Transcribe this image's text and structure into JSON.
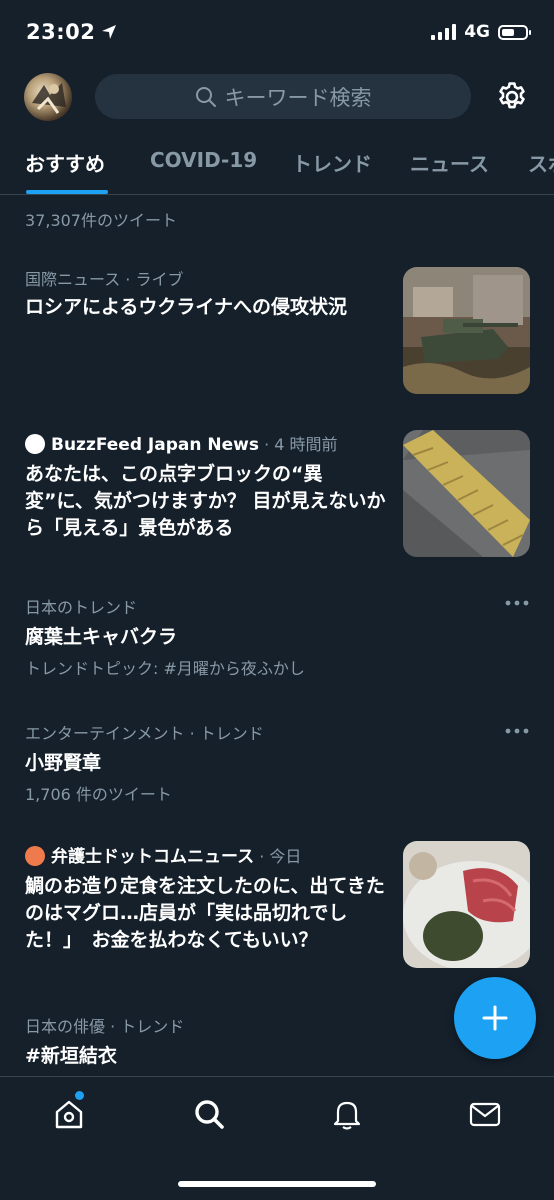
{
  "status_bar": {
    "time": "23:02",
    "network": "4G"
  },
  "header": {
    "search_placeholder": "キーワード検索"
  },
  "tabs": [
    {
      "label": "おすすめ"
    },
    {
      "label": "COVID-19"
    },
    {
      "label": "トレンド"
    },
    {
      "label": "ニュース"
    },
    {
      "label": "スポ"
    }
  ],
  "feed": {
    "partial_item": {
      "count": "37,307件のツイート"
    },
    "items": [
      {
        "category": "国際ニュース",
        "category_suffix": "· ライブ",
        "title": "ロシアによるウクライナへの侵攻状況"
      },
      {
        "source": "BuzzFeed Japan News",
        "time": "· 4 時間前",
        "title": "あなたは、この点字ブロックの“異変”に、気がつけますか？ 目が見えないから「見える」景色がある"
      },
      {
        "category": "日本のトレンド",
        "title": "腐葉土キャバクラ",
        "sub": "トレンドトピック: #月曜から夜ふかし"
      },
      {
        "category": "エンターテインメント · トレンド",
        "title": "小野賢章",
        "sub": "1,706 件のツイート"
      },
      {
        "source": "弁護士ドットコムニュース",
        "time": "· 今日",
        "title": "鯛のお造り定食を注文したのに、出てきたのはマグロ…店員が「実は品切れでした！」　お金を払わなくてもいい？"
      },
      {
        "category": "日本の俳優 · トレンド",
        "title": "#新垣結衣"
      }
    ]
  },
  "colors": {
    "background": "#15202b",
    "accent": "#1da1f2",
    "secondary_text": "#8899a6",
    "search_bg": "#253341"
  }
}
